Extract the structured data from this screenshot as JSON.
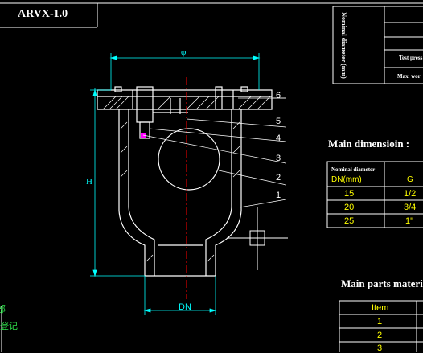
{
  "drawing": {
    "title": "ARVX-1.0",
    "colors": {
      "background": "#000000",
      "outline": "#ffffff",
      "dimension": "#00ffff",
      "centerline": "#ff0000",
      "leader": "#ffffff",
      "text_yellow": "#ffff00",
      "text_green": "#2ee04a"
    },
    "dimension_labels": {
      "diameter": "φ",
      "height": "H",
      "nominal": "DN"
    },
    "part_numbers": [
      "6",
      "5",
      "4",
      "3",
      "2",
      "1"
    ]
  },
  "title_block": {
    "vertical_label": "Nominal diameter (mm)",
    "row1": "Test press",
    "row2": "Max. wor"
  },
  "main_dimension": {
    "heading": "Main dimensioin :",
    "col_header": "Nominal diameter",
    "col_header_unit": "DN(mm)",
    "col_g": "G",
    "rows": [
      {
        "dn": "15",
        "g": "1/2"
      },
      {
        "dn": "20",
        "g": "3/4"
      },
      {
        "dn": "25",
        "g": "1\""
      }
    ]
  },
  "parts_material": {
    "heading": "Main parts material :",
    "col_item": "Item",
    "rows": [
      "1",
      "2",
      "3"
    ]
  },
  "left_margin_text": [
    "部",
    "登记"
  ]
}
